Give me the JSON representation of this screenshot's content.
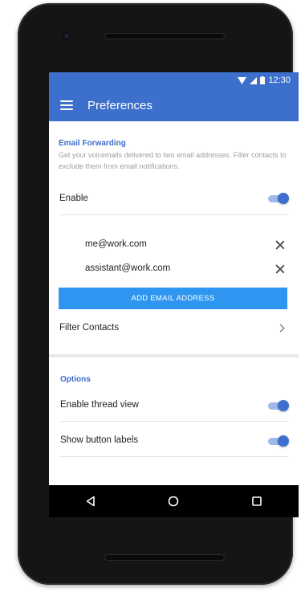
{
  "status_bar": {
    "time": "12:30"
  },
  "app_bar": {
    "title": "Preferences",
    "menu_icon": "menu-icon"
  },
  "email_forwarding": {
    "title": "Email Forwarding",
    "description": "Get your voicemails delivered to two email addresses. Filter contacts to exclude them from email notifications.",
    "enable_label": "Enable",
    "enable_on": true,
    "emails": [
      "me@work.com",
      "assistant@work.com"
    ],
    "add_button_label": "ADD EMAIL ADDRESS",
    "filter_contacts_label": "Filter Contacts"
  },
  "options": {
    "title": "Options",
    "items": [
      {
        "label": "Enable thread view",
        "on": true
      },
      {
        "label": "Show button labels",
        "on": true
      }
    ]
  },
  "nav": {
    "back": "back-icon",
    "home": "home-icon",
    "recents": "recents-icon"
  },
  "colors": {
    "primary": "#3d6fcc",
    "button": "#2e96f0",
    "toggle_track": "#9fb8e8"
  }
}
